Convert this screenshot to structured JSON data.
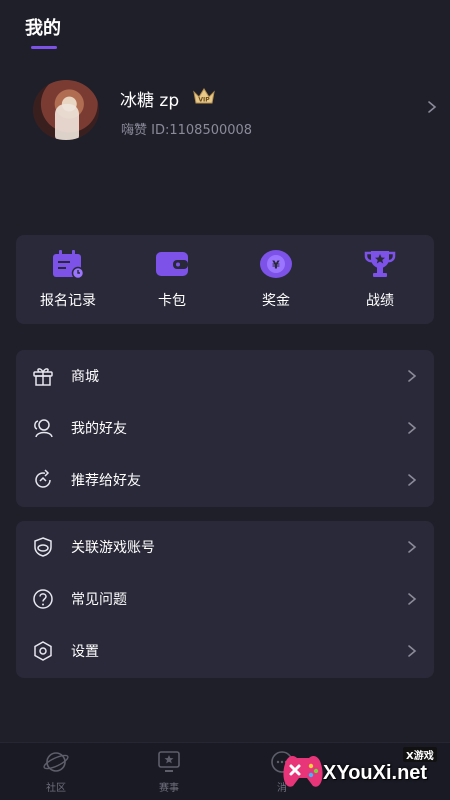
{
  "header": {
    "title": "我的"
  },
  "profile": {
    "name": "冰糖 zp",
    "id_text": "嗨赞 ID:1108500008",
    "badge": "VIP"
  },
  "quick_actions": [
    {
      "label": "报名记录",
      "icon": "calendar-icon"
    },
    {
      "label": "卡包",
      "icon": "wallet-icon"
    },
    {
      "label": "奖金",
      "icon": "yen-coin-icon"
    },
    {
      "label": "战绩",
      "icon": "trophy-icon"
    }
  ],
  "menu_group_1": [
    {
      "label": "商城",
      "icon": "gift-icon"
    },
    {
      "label": "我的好友",
      "icon": "friends-icon"
    },
    {
      "label": "推荐给好友",
      "icon": "share-icon"
    }
  ],
  "menu_group_2": [
    {
      "label": "关联游戏账号",
      "icon": "link-game-icon"
    },
    {
      "label": "常见问题",
      "icon": "question-icon"
    },
    {
      "label": "设置",
      "icon": "settings-icon"
    }
  ],
  "tabbar": [
    {
      "label": "社区",
      "icon": "planet-icon"
    },
    {
      "label": "赛事",
      "icon": "trophy-tab-icon"
    },
    {
      "label": "消",
      "icon": "message-icon"
    }
  ],
  "watermark": {
    "text": "XYouXi.net",
    "sub": "X游戏"
  },
  "colors": {
    "background": "#1f1f2a",
    "card": "#2a2939",
    "accent": "#7c52e8",
    "muted": "#8a8a99"
  }
}
